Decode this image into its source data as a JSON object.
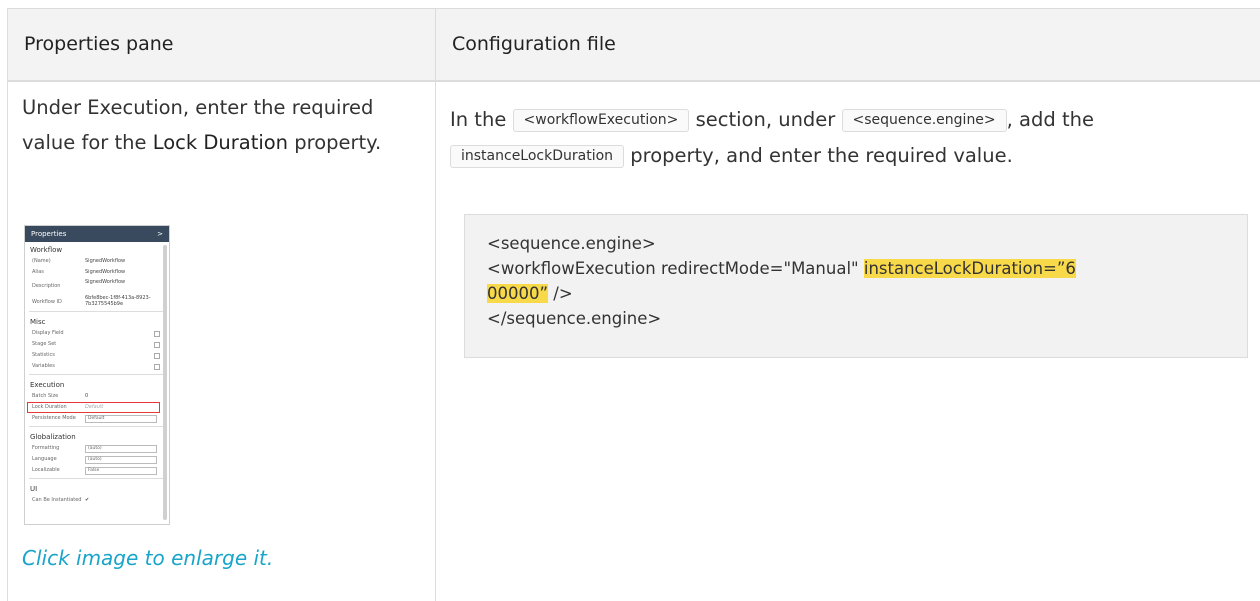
{
  "table": {
    "headers": [
      "Properties pane",
      "Configuration file"
    ]
  },
  "left": {
    "text_before": "Under Execution, enter the required value for the ",
    "bold_term": "Lock Duration",
    "text_after": " property.",
    "caption": "Click image to enlarge it."
  },
  "right": {
    "p1": "In the ",
    "code1": "<workflowExecution>",
    "p2": " section, under ",
    "code2": "<sequence.engine>",
    "p3": ", add the ",
    "code3": "instanceLockDuration",
    "p4": " property, and enter the required value.",
    "codeblock": {
      "line1": "<sequence.engine>",
      "line2_pre": "<workflowExecution redirectMode=\"Manual\" ",
      "line2_hl_a": "instanceLockDuration=”6",
      "line3_hl": "00000”",
      "line3_post": " />",
      "line4": "</sequence.engine>"
    }
  },
  "screenshot": {
    "title": "Properties",
    "chevron": ">",
    "sections": {
      "workflow": "Workflow",
      "misc": "Misc",
      "execution": "Execution",
      "globalization": "Globalization",
      "ui": "UI"
    },
    "workflow_rows": [
      {
        "label": "(Name)",
        "value": "SignedWorkflow"
      },
      {
        "label": "Alias",
        "value": "SignedWorkflow"
      },
      {
        "label": "Description",
        "value": "SignedWorkflow"
      },
      {
        "label": "Workflow ID",
        "value": "6bfe8bec-1f8f-413a-8923-7b3275545b9e"
      }
    ],
    "misc_rows": [
      "Display Field",
      "Stage Set",
      "Statistics",
      "Variables"
    ],
    "execution_rows": [
      {
        "label": "Batch Size",
        "value": "0"
      },
      {
        "label": "Lock Duration",
        "value": "Default"
      },
      {
        "label": "Persistence Mode",
        "value": "Default"
      }
    ],
    "globalization_rows": [
      {
        "label": "Formatting",
        "value": "(auto)"
      },
      {
        "label": "Language",
        "value": "(auto)"
      },
      {
        "label": "Localizable",
        "value": "False"
      }
    ],
    "ui_rows": [
      {
        "label": "Can Be Instantiated",
        "value": "✔"
      }
    ]
  },
  "colors": {
    "header_bg": "#f3f3f3",
    "highlight": "#f8d94a",
    "link": "#19a5c9",
    "red_outline": "#e53935"
  }
}
